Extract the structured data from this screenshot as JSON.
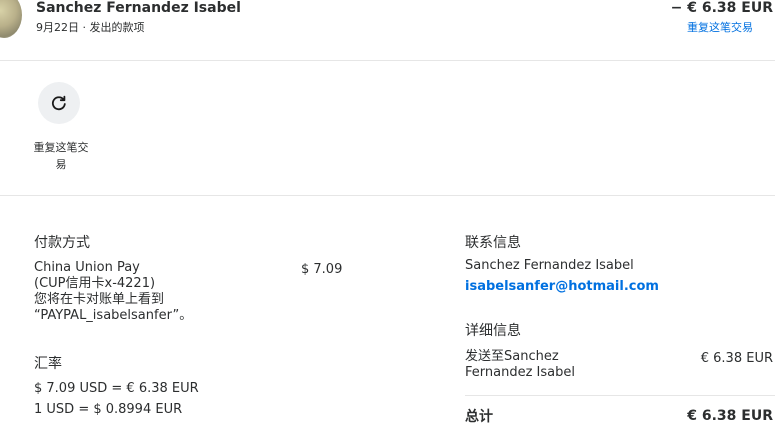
{
  "header": {
    "name": "Sanchez Fernandez Isabel",
    "subline": "9月22日 · 发出的款项",
    "amount": "− € 6.38 EUR",
    "repeat_link": "重复这笔交易"
  },
  "actions": {
    "repeat_line1": "重复这笔交",
    "repeat_line2": "易"
  },
  "payment": {
    "title": "付款方式",
    "method_line1": "China Union Pay",
    "method_line2": "(CUP信用卡x-4221)",
    "method_line3": "您将在卡对账单上看到",
    "method_line4": "“PAYPAL_isabelsanfer”。",
    "amount": "$ 7.09"
  },
  "exchange": {
    "title": "汇率",
    "line1": "$ 7.09 USD = € 6.38 EUR",
    "line2": "1 USD = $ 0.8994 EUR"
  },
  "contact": {
    "title": "联系信息",
    "name": "Sanchez Fernandez Isabel",
    "email": "isabelsanfer@hotmail.com"
  },
  "details": {
    "title": "详细信息",
    "sent_line1": "发送至Sanchez",
    "sent_line2": "Fernandez Isabel",
    "sent_amount": "€ 6.38 EUR",
    "total_label": "总计",
    "total_amount": "€ 6.38 EUR"
  },
  "colors": {
    "link": "#0070e0",
    "text": "#2c2e2f",
    "divider": "#e6e6e6"
  }
}
